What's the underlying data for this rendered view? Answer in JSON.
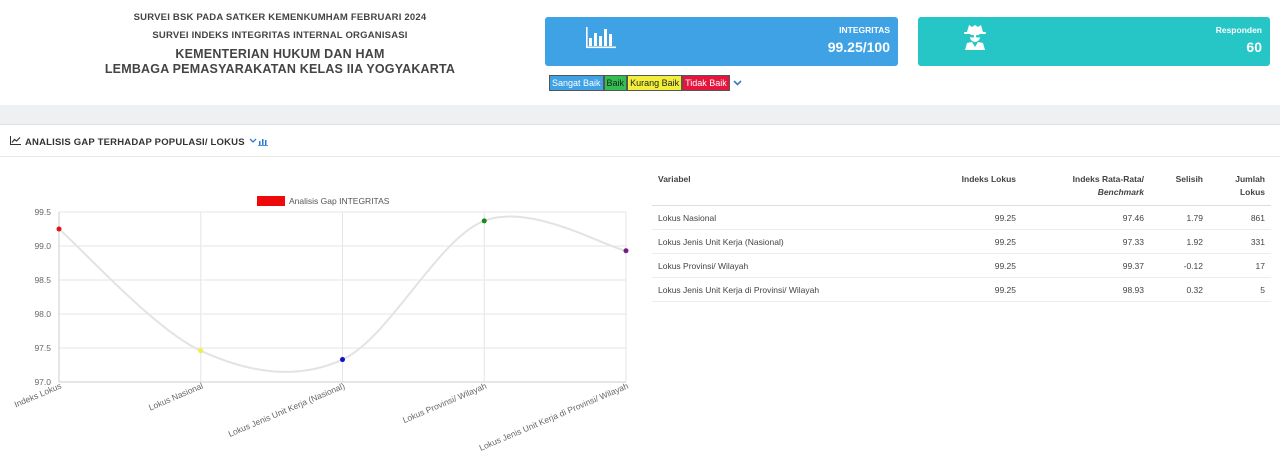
{
  "header": {
    "line1": "SURVEI BSK PADA SATKER KEMENKUMHAM FEBRUARI 2024",
    "line2": "SURVEI INDEKS INTEGRITAS INTERNAL ORGANISASI",
    "line3": "KEMENTERIAN HUKUM DAN HAM",
    "line4": "LEMBAGA PEMASYARAKATAN KELAS IIA YOGYAKARTA"
  },
  "cards": {
    "integritas": {
      "label": "INTEGRITAS",
      "value": "99.25/100",
      "icon": "bar-chart-icon",
      "color": "#3ea2e5"
    },
    "responden": {
      "label": "Responden",
      "value": "60",
      "icon": "user-secret-icon",
      "color": "#26c6c6"
    }
  },
  "legend": {
    "sangat_baik": "Sangat Baik",
    "baik": "Baik",
    "kurang_baik": "Kurang Baik",
    "tidak_baik": "Tidak Baik",
    "toggle_icon": "chevron-down-icon"
  },
  "section": {
    "title": "ANALISIS GAP TERHADAP POPULASI/ LOKUS"
  },
  "chart_data": {
    "type": "line",
    "categories": [
      "Indeks Lokus",
      "Lokus Nasional",
      "Lokus Jenis Unit Kerja (Nasional)",
      "Lokus Provinsi/ Wilayah",
      "Lokus Jenis Unit Kerja di Provinsi/ Wilayah"
    ],
    "series": [
      {
        "name": "Analisis Gap INTEGRITAS",
        "values": [
          99.25,
          97.46,
          97.33,
          99.37,
          98.93
        ]
      }
    ],
    "point_colors": [
      "#e5101a",
      "#f2ef3a",
      "#1010d0",
      "#1a8a1a",
      "#7a1a8a"
    ],
    "legend_color": "#ee0a0a",
    "ylim": [
      97.0,
      99.5
    ],
    "yticks": [
      "97.0",
      "97.5",
      "98.0",
      "98.5",
      "99.0",
      "99.5"
    ],
    "grid": true,
    "legend_position": "top"
  },
  "table": {
    "headers": {
      "variabel": "Variabel",
      "indeks_lokus": "Indeks Lokus",
      "rata_rata": "Indeks Rata-Rata/",
      "benchmark": "Benchmark",
      "selisih": "Selisih",
      "jumlah": "Jumlah",
      "lokus": "Lokus"
    },
    "rows": [
      {
        "variabel": "Lokus Nasional",
        "indeks": "99.25",
        "rata": "97.46",
        "selisih": "1.79",
        "jumlah": "861"
      },
      {
        "variabel": "Lokus Jenis Unit Kerja (Nasional)",
        "indeks": "99.25",
        "rata": "97.33",
        "selisih": "1.92",
        "jumlah": "331"
      },
      {
        "variabel": "Lokus Provinsi/ Wilayah",
        "indeks": "99.25",
        "rata": "99.37",
        "selisih": "-0.12",
        "jumlah": "17"
      },
      {
        "variabel": "Lokus Jenis Unit Kerja di Provinsi/ Wilayah",
        "indeks": "99.25",
        "rata": "98.93",
        "selisih": "0.32",
        "jumlah": "5"
      }
    ]
  }
}
